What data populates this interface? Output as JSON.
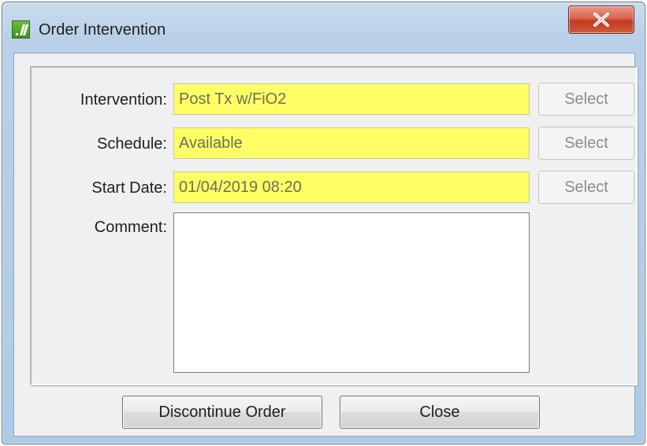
{
  "window": {
    "title": "Order Intervention",
    "app_icon": "slash-logo-icon",
    "close_icon": "close-x-icon"
  },
  "form": {
    "intervention": {
      "label": "Intervention:",
      "value": "Post Tx w/FiO2",
      "button": "Select"
    },
    "schedule": {
      "label": "Schedule:",
      "value": "Available",
      "button": "Select"
    },
    "start_date": {
      "label": "Start Date:",
      "value": "01/04/2019 08:20",
      "button": "Select"
    },
    "comment": {
      "label": "Comment:",
      "value": ""
    }
  },
  "actions": {
    "discontinue_label": "Discontinue Order",
    "close_label": "Close"
  },
  "colors": {
    "required_field_bg": "#ffff66",
    "close_button": "#c7432b",
    "window_frame": "#b9d0e8"
  }
}
